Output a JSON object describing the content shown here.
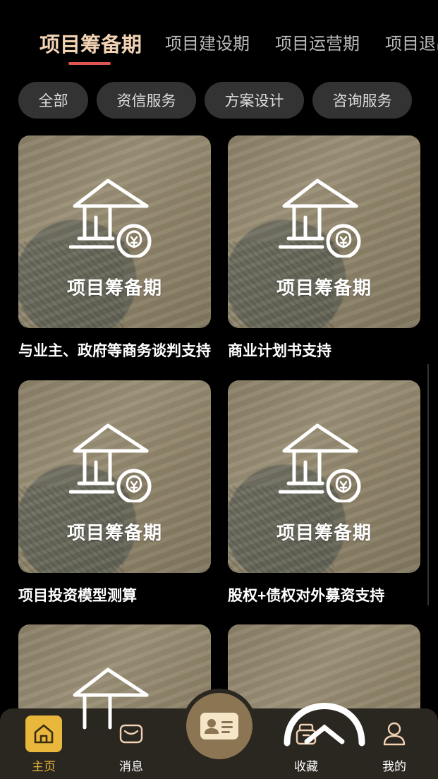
{
  "tabs": [
    {
      "label": "项目筹备期",
      "active": true
    },
    {
      "label": "项目建设期",
      "active": false
    },
    {
      "label": "项目运营期",
      "active": false
    },
    {
      "label": "项目退出期",
      "active": false
    }
  ],
  "filters": [
    "全部",
    "资信服务",
    "方案设计",
    "咨询服务"
  ],
  "cards": [
    {
      "image_label": "项目筹备期",
      "title": "与业主、政府等商务谈判支持",
      "icon": "house-money-icon"
    },
    {
      "image_label": "项目筹备期",
      "title": "商业计划书支持",
      "icon": "house-money-icon"
    },
    {
      "image_label": "项目筹备期",
      "title": "项目投资模型测算",
      "icon": "house-money-icon"
    },
    {
      "image_label": "项目筹备期",
      "title": "股权+债权对外募资支持",
      "icon": "house-money-icon"
    },
    {
      "image_label": "",
      "title": "",
      "icon": "house-money-icon"
    },
    {
      "image_label": "",
      "title": "",
      "icon": "helmet-icon"
    }
  ],
  "bottom_nav": {
    "home": {
      "label": "主页",
      "icon": "home-icon",
      "active": true
    },
    "messages": {
      "label": "消息",
      "icon": "message-icon",
      "active": false
    },
    "center": {
      "icon": "id-card-icon"
    },
    "favorites": {
      "label": "收藏",
      "icon": "box-icon",
      "active": false
    },
    "mine": {
      "label": "我的",
      "icon": "user-icon",
      "active": false
    }
  },
  "colors": {
    "accent_tab": "#f1d2b3",
    "underline": "#e25651",
    "nav_active": "#e8b73c",
    "chip_bg": "#333333",
    "nav_bg": "#2a2620"
  }
}
